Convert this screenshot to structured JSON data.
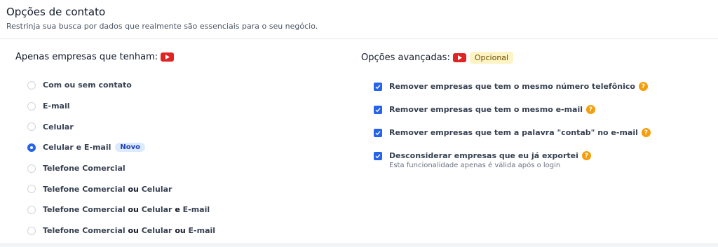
{
  "header": {
    "title": "Opções de contato",
    "subtitle": "Restrinja sua busca por dados que realmente são essenciais para o seu negócio."
  },
  "left_section": {
    "title": "Apenas empresas que tenham:",
    "icon": "youtube-icon",
    "options": [
      {
        "parts": [
          {
            "t": "Com ou sem contato",
            "b": false
          }
        ],
        "checked": false
      },
      {
        "parts": [
          {
            "t": "E-mail",
            "b": false
          }
        ],
        "checked": false
      },
      {
        "parts": [
          {
            "t": "Celular",
            "b": false
          }
        ],
        "checked": false
      },
      {
        "parts": [
          {
            "t": "Celular e E-mail",
            "b": false
          }
        ],
        "checked": true,
        "badge": "Novo"
      },
      {
        "parts": [
          {
            "t": "Telefone Comercial",
            "b": false
          }
        ],
        "checked": false
      },
      {
        "parts": [
          {
            "t": "Telefone Comercial ",
            "b": false
          },
          {
            "t": "ou",
            "b": true
          },
          {
            "t": " Celular",
            "b": false
          }
        ],
        "checked": false
      },
      {
        "parts": [
          {
            "t": "Telefone Comercial ",
            "b": false
          },
          {
            "t": "ou",
            "b": true
          },
          {
            "t": " Celular ",
            "b": false
          },
          {
            "t": "e",
            "b": true
          },
          {
            "t": " E-mail",
            "b": false
          }
        ],
        "checked": false
      },
      {
        "parts": [
          {
            "t": "Telefone Comercial ",
            "b": false
          },
          {
            "t": "ou",
            "b": true
          },
          {
            "t": " Celular ",
            "b": false
          },
          {
            "t": "ou",
            "b": true
          },
          {
            "t": " E-mail",
            "b": false
          }
        ],
        "checked": false
      }
    ]
  },
  "right_section": {
    "title": "Opções avançadas:",
    "icon": "youtube-icon",
    "badge": "Opcional",
    "options": [
      {
        "label": "Remover empresas que tem o mesmo número telefônico",
        "checked": true,
        "help": "?"
      },
      {
        "label": "Remover empresas que tem o mesmo e-mail",
        "checked": true,
        "help": "?"
      },
      {
        "label": "Remover empresas que tem a palavra \"contab\" no e-mail",
        "checked": true,
        "help": "?"
      },
      {
        "label": "Desconsiderar empresas que eu já exportei",
        "checked": true,
        "help": "?",
        "note": "Esta funcionalidade apenas é válida após o login"
      }
    ]
  },
  "colors": {
    "accent": "#2563eb",
    "youtube": "#e02424",
    "help": "#f59e0b",
    "badge_opcional_bg": "#fdf3c4",
    "badge_novo_bg": "#dbeafe"
  }
}
